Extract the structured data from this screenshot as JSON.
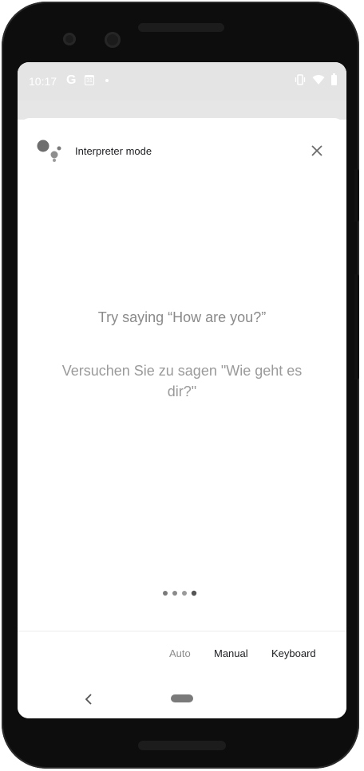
{
  "status_bar": {
    "time": "10:17",
    "g_label": "G",
    "calendar_day": "31",
    "icons": [
      "google-icon",
      "calendar-icon",
      "notification-dot",
      "vibrate-icon",
      "wifi-icon",
      "battery-icon"
    ]
  },
  "header": {
    "title": "Interpreter mode",
    "logo_icon": "google-assistant-icon",
    "close_icon": "close-icon"
  },
  "prompt": {
    "main": "Try saying “How are you?”",
    "translated": "Versuchen Sie zu sagen \"Wie geht es dir?\""
  },
  "listening_indicator": {
    "icon": "listening-dots-icon"
  },
  "mode_tabs": {
    "auto": "Auto",
    "manual": "Manual",
    "keyboard": "Keyboard",
    "selected": "Auto"
  },
  "nav": {
    "back_icon": "back-icon",
    "home_icon": "home-pill-icon"
  },
  "colors": {
    "status_bar_bg": "#e4e4e4",
    "prompt_text": "#8a8a8a",
    "active_tab": "#202124",
    "inactive_tab": "#8d8d8d"
  }
}
